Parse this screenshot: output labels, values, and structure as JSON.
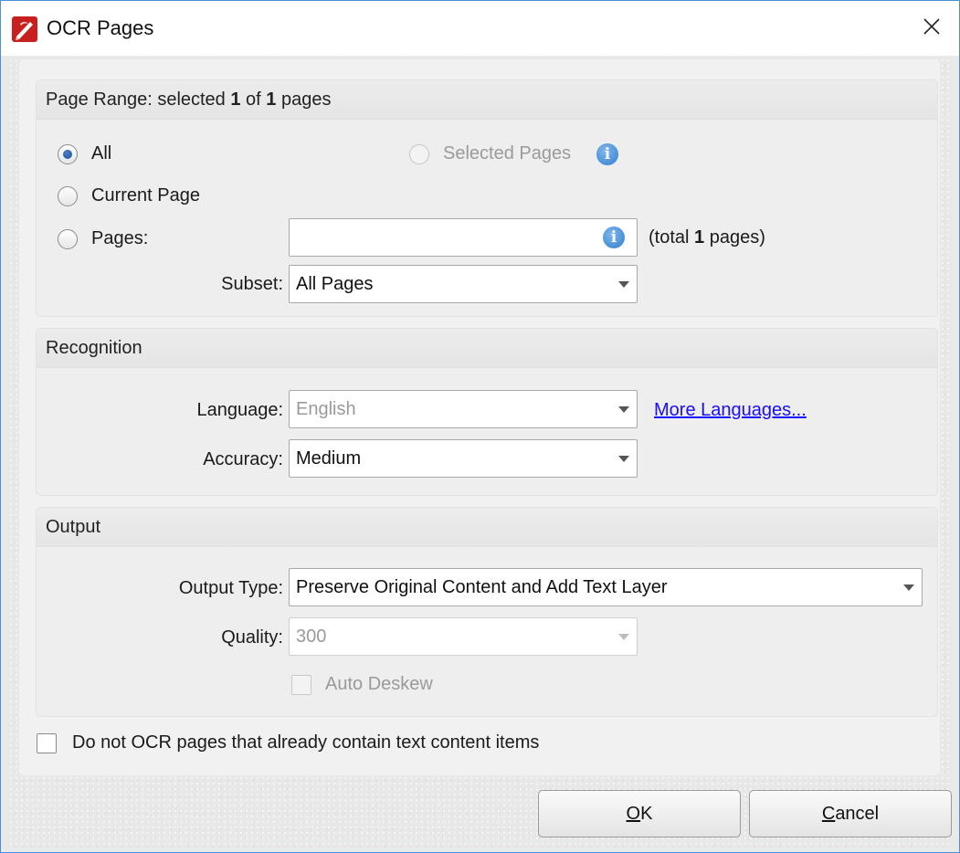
{
  "window": {
    "title": "OCR Pages",
    "icon": "pdf-editor-app-icon",
    "close_icon": "close-icon"
  },
  "page_range": {
    "header_prefix": "Page Range: selected ",
    "selected_count": "1",
    "header_middle": " of ",
    "total_count": "1",
    "header_suffix": " pages",
    "options": {
      "all": {
        "label": "All",
        "checked": true
      },
      "selected_pages": {
        "label": "Selected Pages",
        "enabled": false
      },
      "current_page": {
        "label": "Current Page",
        "checked": false
      },
      "pages": {
        "label": "Pages:",
        "checked": false
      }
    },
    "pages_input_value": "",
    "total_prefix": "(total ",
    "total_value": "1",
    "total_suffix": " pages)",
    "subset_label": "Subset:",
    "subset_value": "All Pages"
  },
  "recognition": {
    "header": "Recognition",
    "language_label": "Language:",
    "language_value": "English",
    "more_languages_link": "More Languages...",
    "accuracy_label": "Accuracy:",
    "accuracy_value": "Medium"
  },
  "output": {
    "header": "Output",
    "output_type_label": "Output Type:",
    "output_type_value": "Preserve Original Content and Add Text Layer",
    "quality_label": "Quality:",
    "quality_value": "300",
    "auto_deskew_label": "Auto Deskew",
    "auto_deskew_checked": false
  },
  "skip_text_pages": {
    "label": "Do not OCR pages that already contain text content items",
    "checked": false
  },
  "buttons": {
    "ok_mnemonic": "O",
    "ok_rest": "K",
    "cancel_mnemonic": "C",
    "cancel_rest": "ancel"
  },
  "colors": {
    "accent": "#1a4f9c",
    "info_icon": "#2f7fd0",
    "link": "#1a0dff",
    "window_border": "#4a90d9"
  }
}
